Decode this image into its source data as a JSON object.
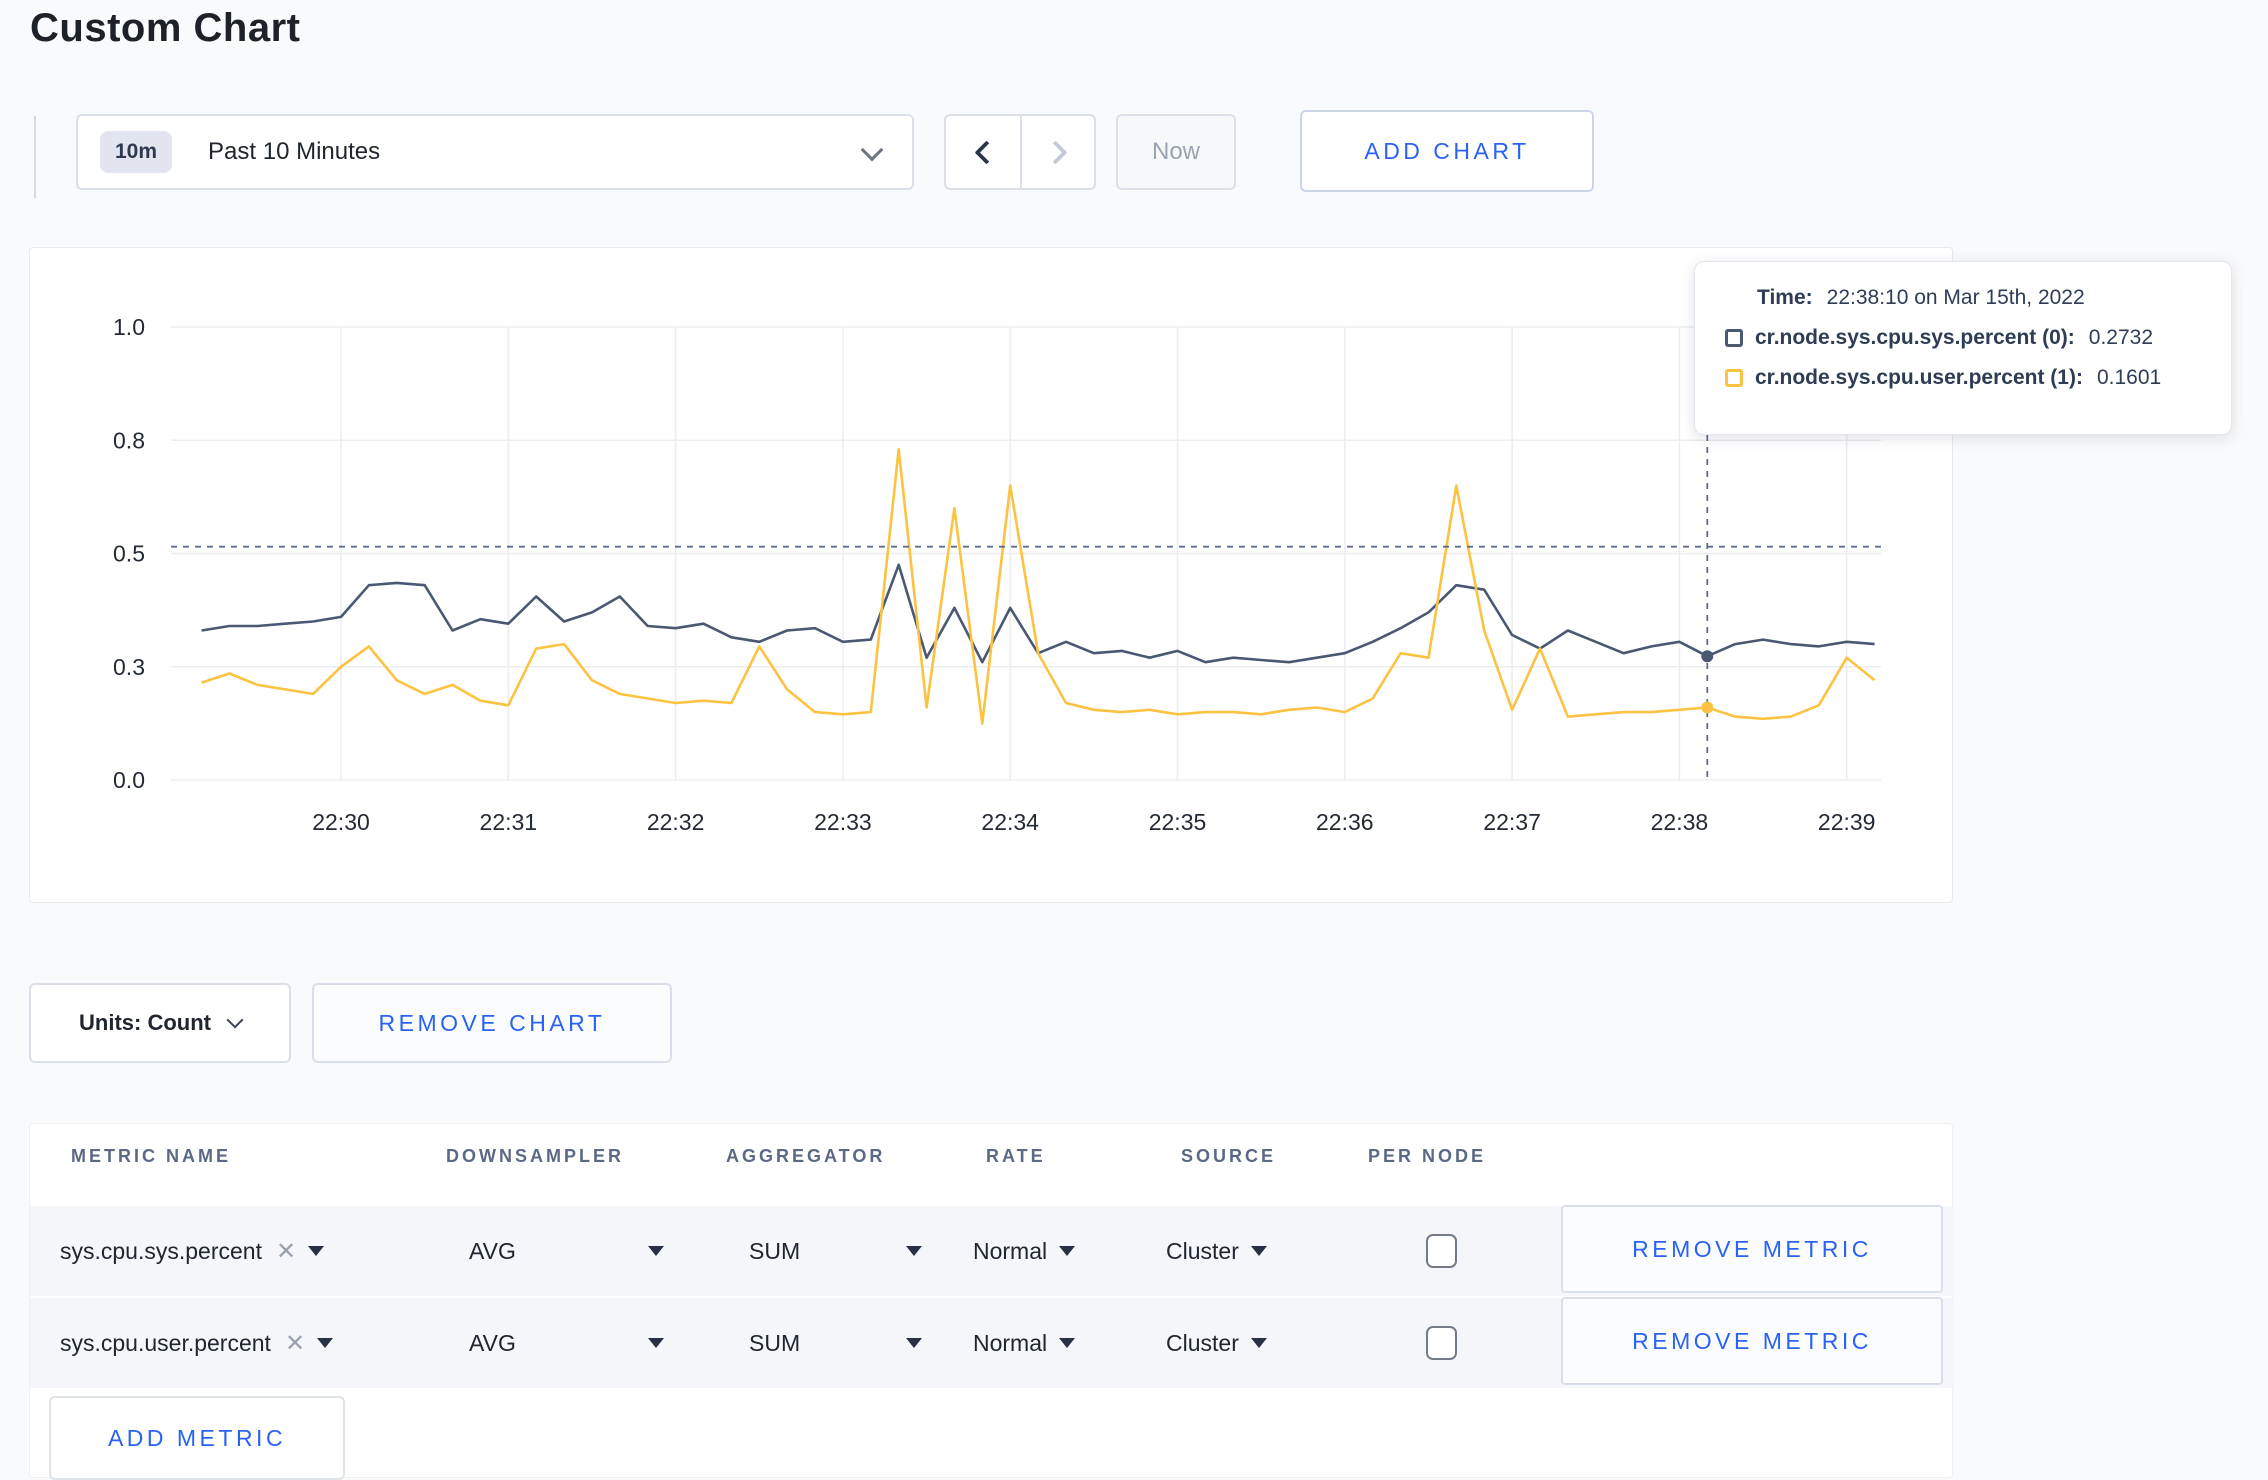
{
  "page": {
    "title": "Custom Chart"
  },
  "toolbar": {
    "range_badge": "10m",
    "range_label": "Past 10 Minutes",
    "now_label": "Now",
    "add_chart_label": "ADD CHART"
  },
  "units_row": {
    "units_label": "Units: Count",
    "remove_chart_label": "REMOVE CHART"
  },
  "chart_tooltip": {
    "time_label": "Time:",
    "time_value": "22:38:10 on Mar 15th, 2022",
    "series": [
      {
        "name": "cr.node.sys.cpu.sys.percent (0):",
        "value": "0.2732",
        "color": "#4a5872"
      },
      {
        "name": "cr.node.sys.cpu.user.percent (1):",
        "value": "0.1601",
        "color": "#fcc242"
      }
    ]
  },
  "chart_data": {
    "type": "line",
    "title": "",
    "xlabel": "",
    "ylabel": "",
    "start_time": "22:29:10",
    "sample_interval_seconds": 10,
    "x_tick_labels": [
      "22:30",
      "22:31",
      "22:32",
      "22:33",
      "22:34",
      "22:35",
      "22:36",
      "22:37",
      "22:38",
      "22:39"
    ],
    "x_tick_indices": [
      5,
      11,
      17,
      23,
      29,
      35,
      41,
      47,
      53,
      59
    ],
    "y_ticks": {
      "values": [
        0,
        0.25,
        0.5,
        0.75,
        1
      ],
      "labels": [
        "0.0",
        "0.3",
        "0.5",
        "0.8",
        "1.0"
      ]
    },
    "ylim": [
      0,
      1
    ],
    "grid": true,
    "legend_position": "none",
    "grid_color": "#ebedf0",
    "crosshair_color": "#5e6f8d",
    "series": [
      {
        "name": "cr.node.sys.cpu.sys.percent",
        "color": "#4a5872",
        "values": [
          0.33,
          0.34,
          0.34,
          0.345,
          0.35,
          0.36,
          0.43,
          0.435,
          0.43,
          0.33,
          0.355,
          0.345,
          0.405,
          0.35,
          0.37,
          0.405,
          0.34,
          0.335,
          0.345,
          0.315,
          0.305,
          0.33,
          0.335,
          0.305,
          0.31,
          0.475,
          0.27,
          0.38,
          0.26,
          0.38,
          0.28,
          0.305,
          0.28,
          0.285,
          0.27,
          0.285,
          0.26,
          0.27,
          0.265,
          0.26,
          0.27,
          0.28,
          0.305,
          0.335,
          0.37,
          0.43,
          0.42,
          0.32,
          0.29,
          0.33,
          0.305,
          0.28,
          0.295,
          0.305,
          0.2732,
          0.3,
          0.31,
          0.3,
          0.295,
          0.305,
          0.3
        ]
      },
      {
        "name": "cr.node.sys.cpu.user.percent",
        "color": "#fcc242",
        "values": [
          0.215,
          0.235,
          0.21,
          0.2,
          0.19,
          0.25,
          0.295,
          0.22,
          0.19,
          0.21,
          0.175,
          0.165,
          0.29,
          0.3,
          0.22,
          0.19,
          0.18,
          0.17,
          0.175,
          0.17,
          0.295,
          0.2,
          0.15,
          0.145,
          0.15,
          0.73,
          0.16,
          0.6,
          0.125,
          0.65,
          0.28,
          0.17,
          0.155,
          0.15,
          0.155,
          0.145,
          0.15,
          0.15,
          0.145,
          0.155,
          0.16,
          0.15,
          0.18,
          0.28,
          0.27,
          0.65,
          0.33,
          0.155,
          0.29,
          0.14,
          0.145,
          0.15,
          0.15,
          0.155,
          0.1601,
          0.14,
          0.135,
          0.14,
          0.165,
          0.27,
          0.22
        ]
      }
    ],
    "crosshair": {
      "time": "22:38:10",
      "index": 54,
      "hover_value": 0.515,
      "point_values": [
        0.2732,
        0.1601
      ]
    }
  },
  "metrics_table": {
    "headers": {
      "metric_name": "METRIC NAME",
      "downsampler": "DOWNSAMPLER",
      "aggregator": "AGGREGATOR",
      "rate": "RATE",
      "source": "SOURCE",
      "per_node": "PER NODE"
    },
    "rows": [
      {
        "metric": "sys.cpu.sys.percent",
        "downsampler": "AVG",
        "aggregator": "SUM",
        "rate": "Normal",
        "source": "Cluster",
        "per_node_checked": false,
        "remove_label": "REMOVE METRIC"
      },
      {
        "metric": "sys.cpu.user.percent",
        "downsampler": "AVG",
        "aggregator": "SUM",
        "rate": "Normal",
        "source": "Cluster",
        "per_node_checked": false,
        "remove_label": "REMOVE METRIC"
      }
    ],
    "add_metric_label": "ADD METRIC"
  },
  "icons": {
    "remove_metric_x": "✕"
  }
}
